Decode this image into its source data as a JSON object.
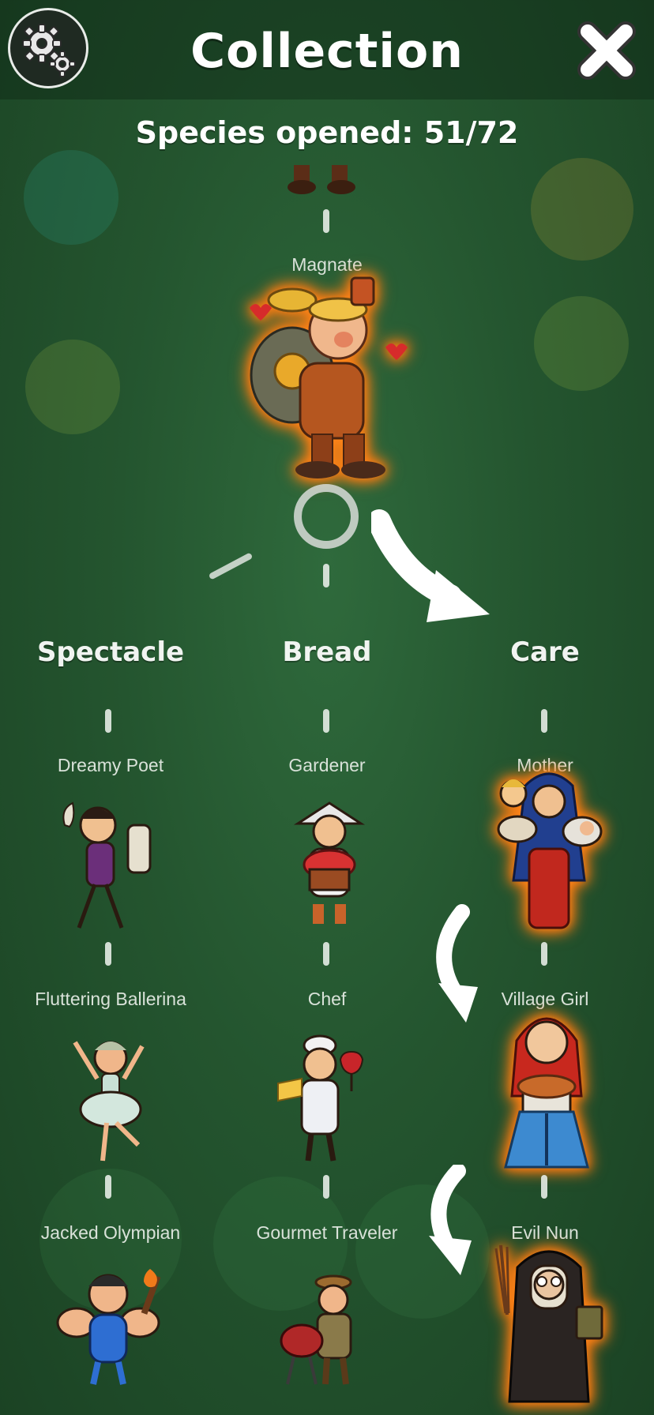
{
  "header": {
    "title": "Collection",
    "settings_icon": "gear-icon",
    "close_icon": "close-icon"
  },
  "progress": {
    "text": "Species opened: 51/72",
    "opened": 51,
    "total": 72
  },
  "top_character": {
    "name": "Magnate",
    "highlighted": true
  },
  "branches": [
    {
      "name": "Spectacle",
      "characters": [
        "Dreamy Poet",
        "Fluttering Ballerina",
        "Jacked Olympian"
      ]
    },
    {
      "name": "Bread",
      "characters": [
        "Gardener",
        "Chef",
        "Gourmet Traveler"
      ]
    },
    {
      "name": "Care",
      "characters": [
        "Mother",
        "Village Girl",
        "Evil Nun"
      ],
      "highlighted": true
    }
  ],
  "colors": {
    "background": "#24552f",
    "glow": "#ff8a1e",
    "text": "#ffffff"
  }
}
